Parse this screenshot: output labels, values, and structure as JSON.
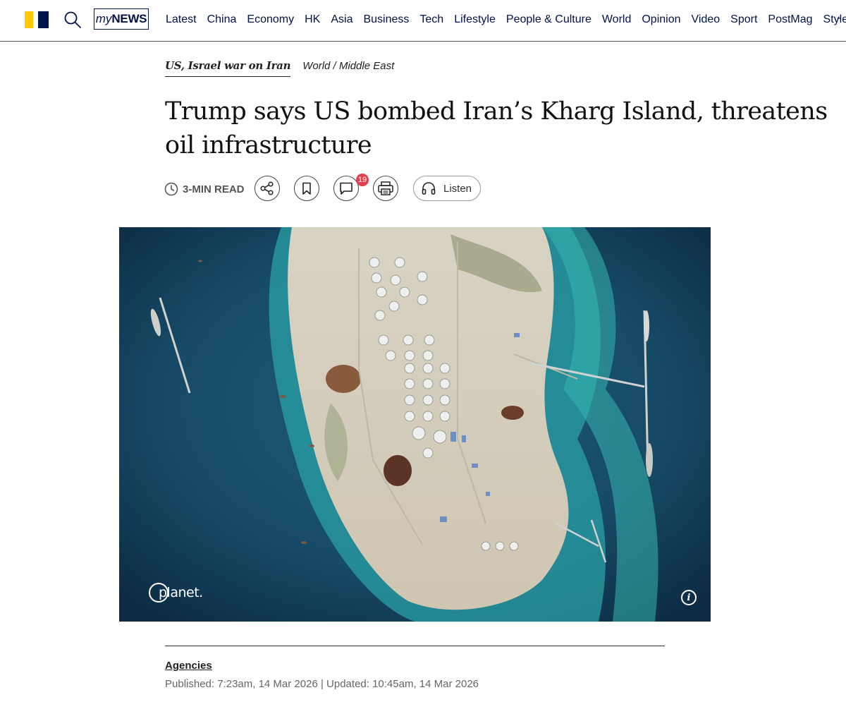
{
  "nav": {
    "mynews_prefix": "my",
    "mynews_suffix": "NEWS",
    "items": [
      "Latest",
      "China",
      "Economy",
      "HK",
      "Asia",
      "Business",
      "Tech",
      "Lifestyle",
      "People & Culture",
      "World",
      "Opinion",
      "Video",
      "Sport",
      "PostMag",
      "Style"
    ],
    "more": "-"
  },
  "article": {
    "topic": "US, Israel war on Iran",
    "section": "World / Middle East",
    "headline": "Trump says US bombed Iran’s Kharg Island, threatens oil infrastructure",
    "read_time": "3-MIN READ",
    "comment_count": "19",
    "listen_label": "Listen",
    "image_credit": "planet.",
    "info_label": "i",
    "author": "Agencies",
    "dates": "Published: 7:23am, 14 Mar 2026 | Updated: 10:45am, 14 Mar 2026"
  },
  "colors": {
    "brand_yellow": "#ffca05",
    "brand_navy": "#001246",
    "badge_red": "#e23f4f"
  }
}
